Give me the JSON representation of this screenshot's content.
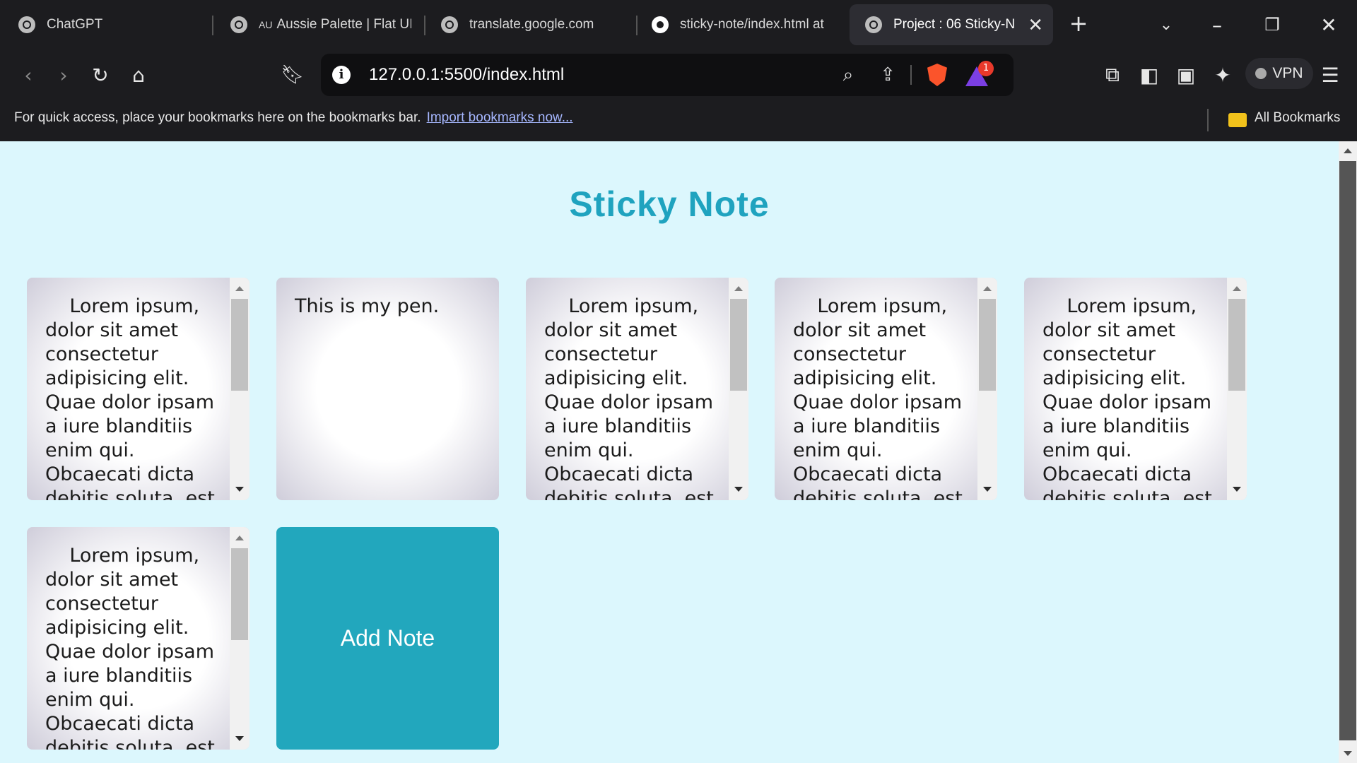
{
  "browser": {
    "tabs": [
      {
        "title": "ChatGPT",
        "prefix": "",
        "icon": "globe-icon"
      },
      {
        "title": "Aussie Palette | Flat UI",
        "prefix": "AU",
        "icon": "globe-icon"
      },
      {
        "title": "translate.google.com",
        "prefix": "",
        "icon": "globe-icon"
      },
      {
        "title": "sticky-note/index.html at",
        "prefix": "",
        "icon": "github-icon"
      },
      {
        "title": "Project : 06 Sticky-N",
        "prefix": "",
        "icon": "globe-icon",
        "active": true
      }
    ],
    "new_tab": "+",
    "url": "127.0.0.1:5500/index.html",
    "rewards_badge": "1",
    "vpn_label": "VPN",
    "bookmarks_bar": {
      "message": "For quick access, place your bookmarks here on the bookmarks bar.",
      "import_link": "Import bookmarks now...",
      "all_bookmarks": "All Bookmarks"
    }
  },
  "page": {
    "title": "Sticky Note",
    "notes": [
      {
        "text": "    Lorem ipsum, dolor sit amet consectetur adipisicing elit. Quae dolor ipsam a iure blanditiis enim qui. Obcaecati dicta debitis soluta, est",
        "scrollable": true
      },
      {
        "text": "This is my pen.",
        "scrollable": false
      },
      {
        "text": "    Lorem ipsum, dolor sit amet consectetur adipisicing elit. Quae dolor ipsam a iure blanditiis enim qui. Obcaecati dicta debitis soluta, est",
        "scrollable": true
      },
      {
        "text": "    Lorem ipsum, dolor sit amet consectetur adipisicing elit. Quae dolor ipsam a iure blanditiis enim qui. Obcaecati dicta debitis soluta, est",
        "scrollable": true
      },
      {
        "text": "    Lorem ipsum, dolor sit amet consectetur adipisicing elit. Quae dolor ipsam a iure blanditiis enim qui. Obcaecati dicta debitis soluta, est",
        "scrollable": true
      },
      {
        "text": "    Lorem ipsum, dolor sit amet consectetur adipisicing elit. Quae dolor ipsam a iure blanditiis enim qui. Obcaecati dicta debitis soluta, est",
        "scrollable": true
      }
    ],
    "add_button": "Add Note"
  },
  "colors": {
    "page_background": "#dcf7fd",
    "title": "#1fa3bf",
    "add_button": "#22a7bd",
    "browser_chrome": "#1c1c1f"
  }
}
